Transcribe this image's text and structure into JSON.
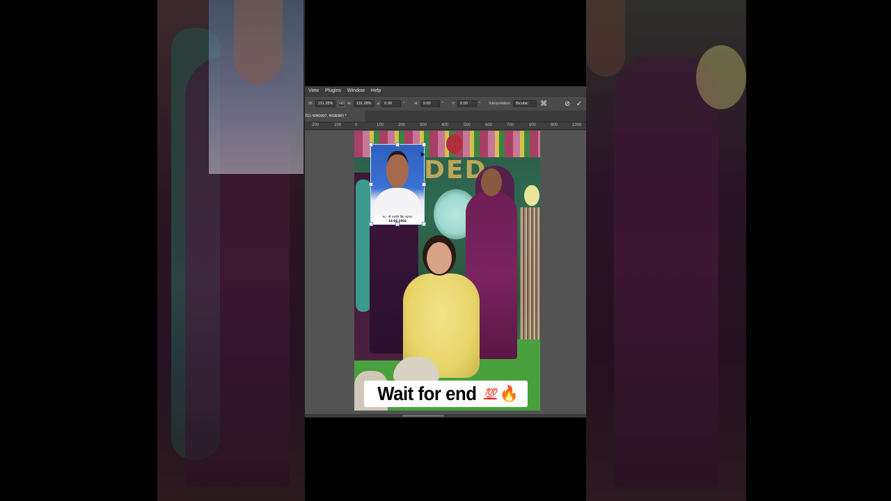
{
  "menubar": {
    "items": [
      "View",
      "Plugins",
      "Window",
      "Help"
    ]
  },
  "options_bar": {
    "w_label": "W:",
    "w_value": "131.28%",
    "link_label": "GD",
    "h_label": "H:",
    "h_value": "131.28%",
    "angle_value": "0.00",
    "angle_unit": "°",
    "hskew_label": "H:",
    "hskew_value": "0.00",
    "hskew_unit": "°",
    "vskew_label": "V:",
    "vskew_value": "0.00",
    "vskew_unit": "°",
    "interpolation_label": "Interpolation:",
    "interpolation_value": "Bicubic",
    "cancel_icon": "cancel-circle-icon",
    "commit_icon": "checkmark-icon"
  },
  "document_tab": {
    "title": "211-WA0007, RGB/8#) *"
  },
  "ruler": {
    "labels": [
      "200",
      "100",
      "0",
      "100",
      "200",
      "300",
      "400",
      "500",
      "600",
      "700",
      "800",
      "900",
      "1000"
    ]
  },
  "portrait": {
    "caption": "स्व.- श्री राजबीर सिंह महलान",
    "date": "14-04-2003"
  },
  "photo": {
    "backdrop_letters": "DED"
  },
  "overlay_caption": {
    "text": "Wait for end",
    "emoji_100": "💯",
    "emoji_fire": "🔥"
  },
  "colors": {
    "menubar_bg": "#3c3c3c",
    "workspace_bg": "#535353",
    "caption_bg": "#ffffff"
  }
}
